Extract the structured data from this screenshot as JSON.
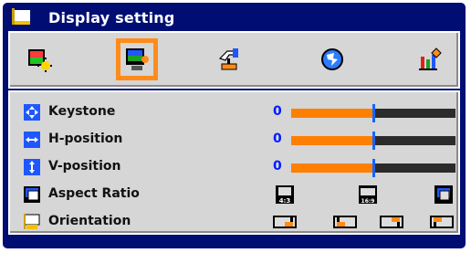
{
  "header": {
    "title": "Display setting",
    "icon": "display-setting-icon"
  },
  "tabs": [
    {
      "name": "image-tab",
      "icon": "image-settings-icon",
      "selected": false
    },
    {
      "name": "display-tab",
      "icon": "display-screen-icon",
      "selected": true
    },
    {
      "name": "setup-tab",
      "icon": "setup-hand-icon",
      "selected": false
    },
    {
      "name": "language-tab",
      "icon": "globe-icon",
      "selected": false
    },
    {
      "name": "advanced-tab",
      "icon": "advanced-bars-icon",
      "selected": false
    }
  ],
  "rows": {
    "keystone": {
      "label": "Keystone",
      "value": "0",
      "level": 0.5
    },
    "hposition": {
      "label": "H-position",
      "value": "0",
      "level": 0.5
    },
    "vposition": {
      "label": "V-position",
      "value": "0",
      "level": 0.5
    },
    "aspect": {
      "label": "Aspect Ratio",
      "options": [
        "4:3",
        "16:9",
        "native"
      ]
    },
    "orientation": {
      "label": "Orientation",
      "options": [
        "front-desktop",
        "rear-desktop",
        "front-ceiling",
        "rear-ceiling"
      ]
    }
  },
  "colors": {
    "background": "#000e74",
    "panel": "#d6d6d6",
    "accent": "#ff7f00",
    "marker": "#1565ff",
    "value": "#001aff"
  }
}
